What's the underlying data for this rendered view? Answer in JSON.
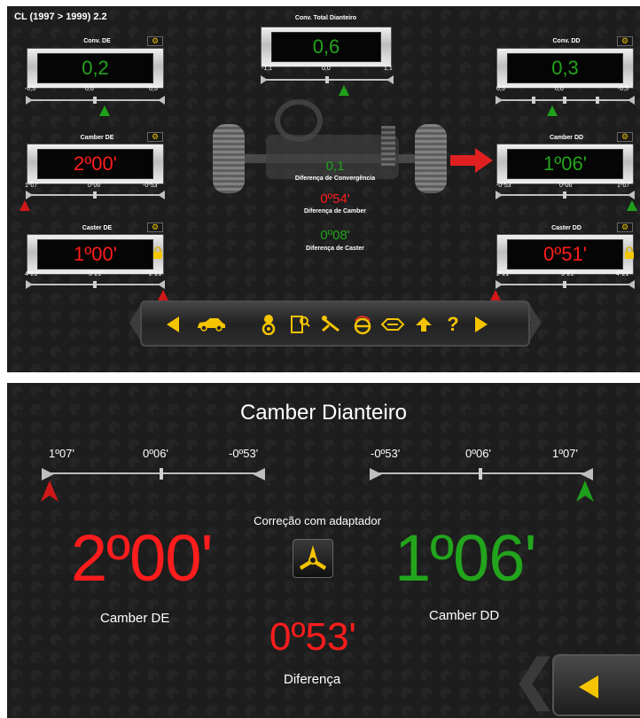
{
  "top": {
    "title": "CL (1997 > 1999) 2.2",
    "conv_total": {
      "label": "Conv. Total Dianteiro",
      "value": "0,6",
      "scale": [
        "-1,1",
        "0,0",
        "1,1"
      ]
    },
    "conv_de": {
      "label": "Conv. DE",
      "value": "0,2",
      "scale": [
        "-0,5",
        "0,0",
        "0,5"
      ]
    },
    "conv_dd": {
      "label": "Conv. DD",
      "value": "0,3",
      "scale": [
        "0,5",
        "0,0",
        "-0,5"
      ]
    },
    "camber_de": {
      "label": "Camber DE",
      "value": "2º00'",
      "scale": [
        "1º07'",
        "0º06'",
        "-0º53'"
      ]
    },
    "camber_dd": {
      "label": "Camber DD",
      "value": "1º06'",
      "scale": [
        "-0º53'",
        "0º06'",
        "1º07'"
      ]
    },
    "caster_de": {
      "label": "Caster DE",
      "value": "1º00'",
      "scale": [
        "4º21'",
        "3º21'",
        "2º21'"
      ]
    },
    "caster_dd": {
      "label": "Caster DD",
      "value": "0º51'",
      "scale": [
        "2º21'",
        "3º21'",
        "4º21'"
      ]
    },
    "diffs": {
      "convergencia": {
        "value": "0,1",
        "label": "Diferença de Convergência"
      },
      "camber": {
        "value": "0º54'",
        "label": "Diferença de Camber"
      },
      "caster": {
        "value": "0º08'",
        "label": "Diferença de Caster"
      }
    },
    "toolbar": {
      "help_label": "?"
    }
  },
  "bottom": {
    "title": "Camber Dianteiro",
    "scale_left": [
      "1º07'",
      "0º06'",
      "-0º53'"
    ],
    "scale_right": [
      "-0º53'",
      "0º06'",
      "1º07'"
    ],
    "adapter_label": "Correção com adaptador",
    "camber_de": {
      "value": "2º00'",
      "label": "Camber DE"
    },
    "camber_dd": {
      "value": "1º06'",
      "label": "Camber DD"
    },
    "diff": {
      "value": "0º53'",
      "label": "Diferença"
    }
  },
  "colors": {
    "good": "#22a51c",
    "bad": "#ff1c1c",
    "accent": "#f5c400"
  },
  "icons": [
    "car-icon",
    "driver-icon",
    "door-icon",
    "wrench-icon",
    "steering-wheel-icon",
    "suspension-icon",
    "up-arrow-icon",
    "help-icon",
    "play-right-icon",
    "play-left-icon",
    "lock-icon",
    "calibration-icon",
    "red-arrow-icon"
  ]
}
